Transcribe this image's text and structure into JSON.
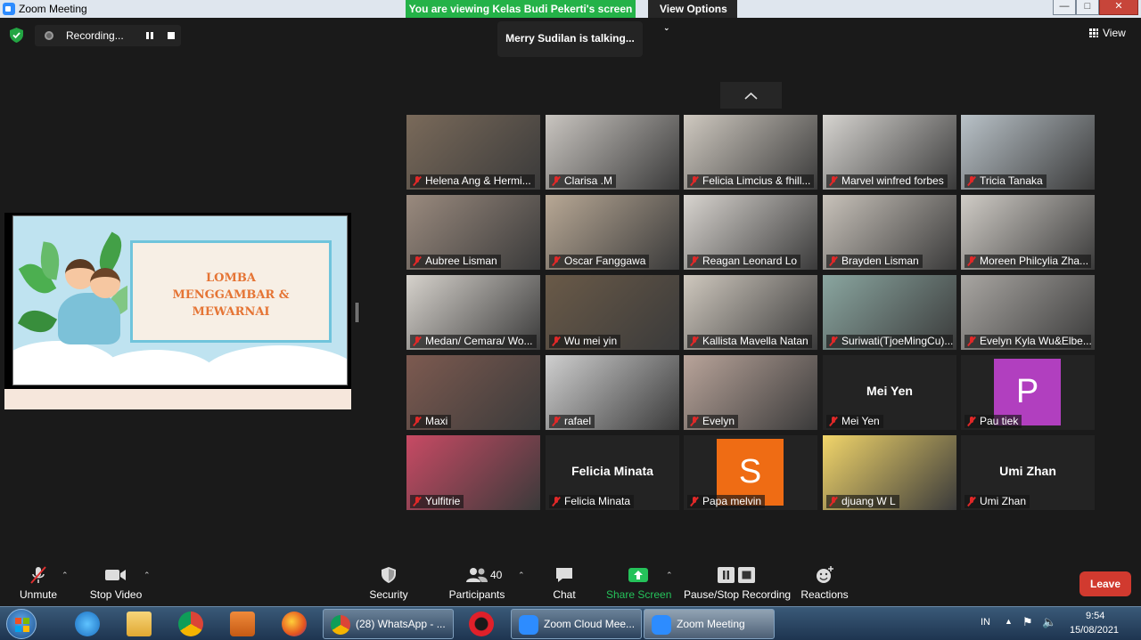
{
  "window": {
    "title": "Zoom Meeting"
  },
  "banner": {
    "viewing": "You are viewing Kelas Budi Pekerti's screen",
    "view_options": "View Options"
  },
  "recording": {
    "label": "Recording..."
  },
  "talking": "Merry Sudilan is talking...",
  "view_button": "View",
  "slide": {
    "title_lines": [
      "LOMBA",
      "MENGGAMBAR &",
      "MEWARNAI"
    ]
  },
  "participants_tiles": [
    {
      "name": "Helena Ang & Hermi...",
      "bg": "#7a6a5a"
    },
    {
      "name": "Clarisa .M",
      "bg": "#c9c5c0"
    },
    {
      "name": "Felicia Limcius & fhill...",
      "bg": "#cfc9c0"
    },
    {
      "name": "Marvel winfred forbes",
      "bg": "#d6d4d0"
    },
    {
      "name": "Tricia Tanaka",
      "bg": "#b9c2c8"
    },
    {
      "name": "Aubree Lisman",
      "bg": "#9a8a7e"
    },
    {
      "name": "Oscar Fanggawa",
      "bg": "#b8a895"
    },
    {
      "name": "Reagan Leonard Lo",
      "bg": "#d8d4cf"
    },
    {
      "name": "Brayden Lisman",
      "bg": "#c8c2ba"
    },
    {
      "name": "Moreen Philcylia Zha...",
      "bg": "#d0ccc6"
    },
    {
      "name": "Medan/ Cemara/ Wo...",
      "bg": "#d6d2cc"
    },
    {
      "name": "Wu mei yin",
      "bg": "#6a5a48"
    },
    {
      "name": "Kallista Mavella Natan",
      "bg": "#cfc8be"
    },
    {
      "name": "Suriwati(TjoeMingCu)...",
      "bg": "#8aa6a0"
    },
    {
      "name": "Evelyn Kyla Wu&Elbe...",
      "bg": "#a9a6a2"
    },
    {
      "name": "Maxi",
      "bg": "#7d5a50"
    },
    {
      "name": "rafael",
      "bg": "#cfcfcf"
    },
    {
      "name": "Evelyn",
      "bg": "#b9a49a"
    },
    {
      "name": "Mei Yen",
      "big": "Mei Yen"
    },
    {
      "name": "Pau tiek",
      "letter": "P",
      "letter_bg": "#b13fbf"
    },
    {
      "name": "Yulfitrie",
      "bg": "#c84a64"
    },
    {
      "name": "Felicia Minata",
      "big": "Felicia Minata"
    },
    {
      "name": "Papa melvin",
      "letter": "S",
      "letter_bg": "#ef6c14"
    },
    {
      "name": "djuang W L",
      "bg": "#f1d56a"
    },
    {
      "name": "Umi Zhan",
      "big": "Umi Zhan"
    }
  ],
  "toolbar": {
    "unmute": "Unmute",
    "stop_video": "Stop Video",
    "security": "Security",
    "participants": "Participants",
    "participants_count": "40",
    "chat": "Chat",
    "share_screen": "Share Screen",
    "pause_stop": "Pause/Stop Recording",
    "reactions": "Reactions",
    "leave": "Leave"
  },
  "taskbar": {
    "whatsapp": "(28) WhatsApp - ...",
    "zoom_cloud": "Zoom Cloud Mee...",
    "zoom_meeting": "Zoom Meeting",
    "lang": "IN",
    "time": "9:54",
    "date": "15/08/2021"
  }
}
